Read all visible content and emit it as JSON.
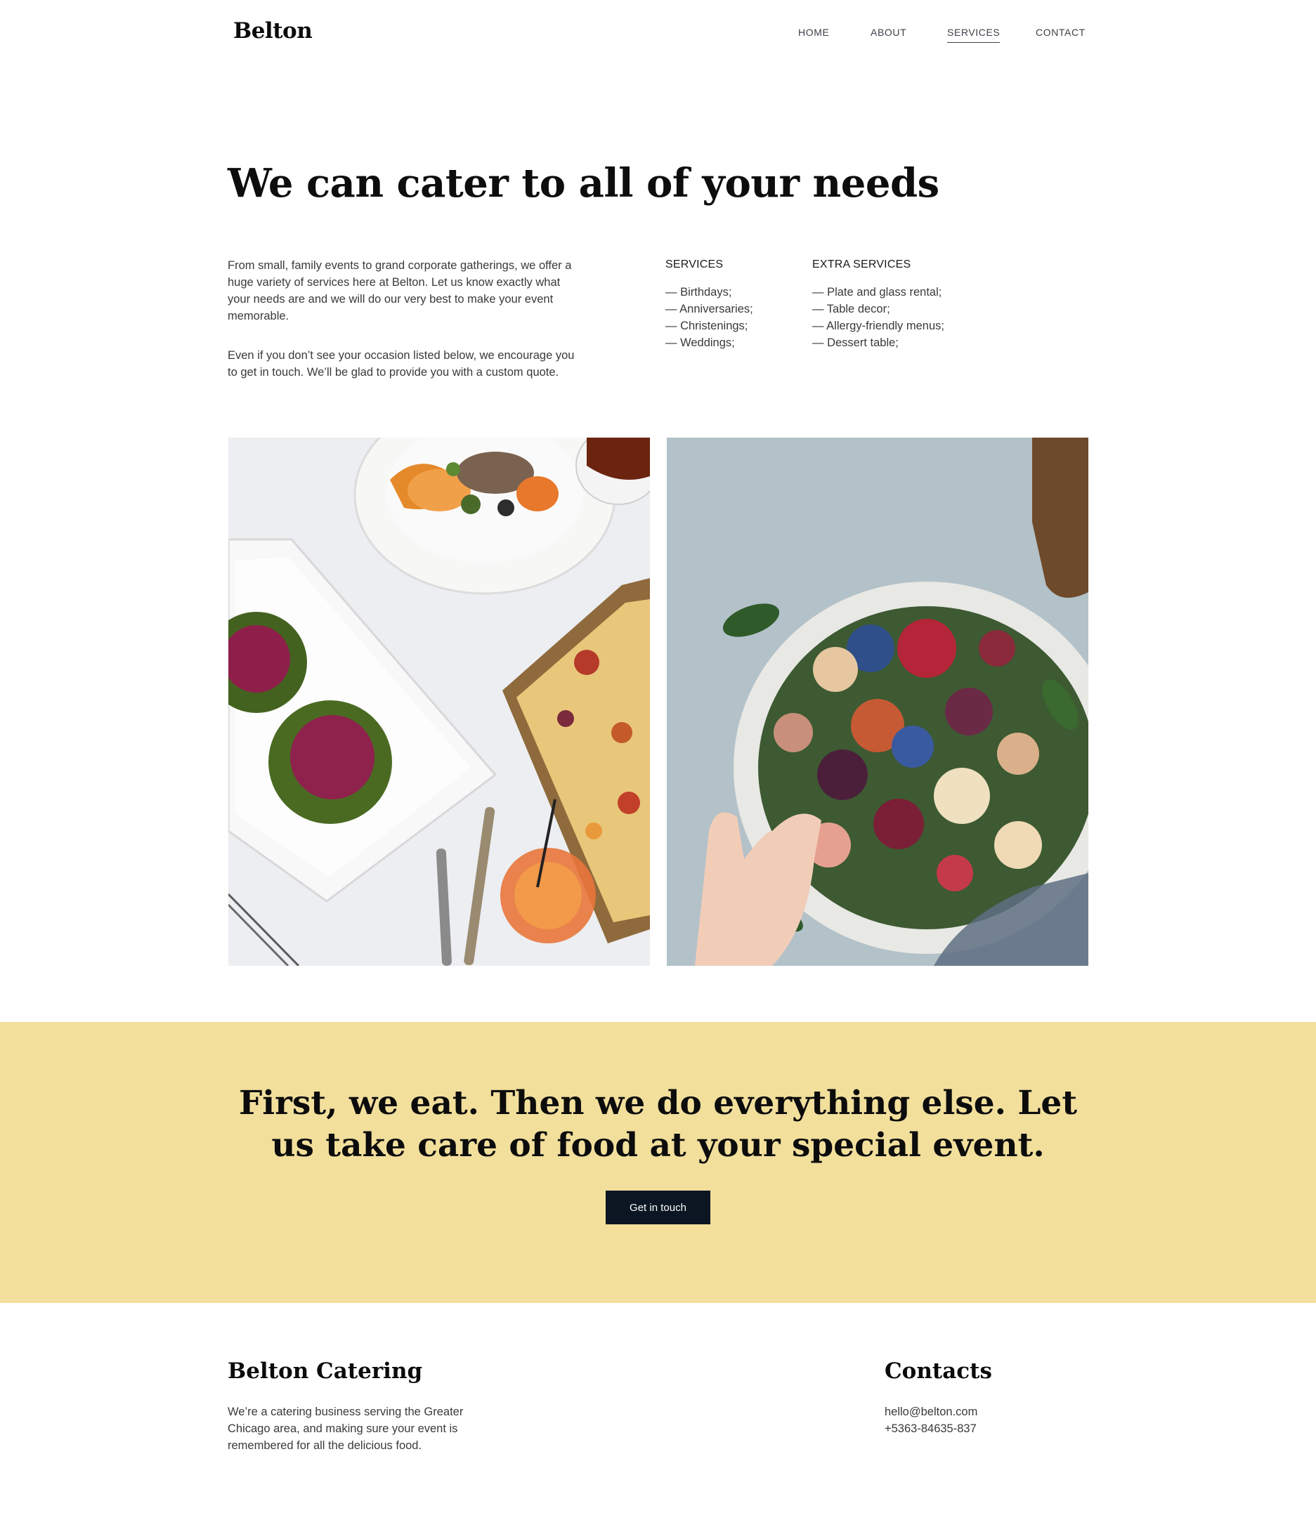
{
  "header": {
    "logo": "Belton",
    "nav": [
      {
        "label": "HOME",
        "active": false
      },
      {
        "label": "ABOUT",
        "active": false
      },
      {
        "label": "SERVICES",
        "active": true
      },
      {
        "label": "CONTACT",
        "active": false
      }
    ]
  },
  "hero": {
    "title": "We can cater to all of your needs",
    "intro": [
      "From small, family events to grand corporate gatherings, we offer a huge variety of services here at Belton. Let us know exactly what your needs are and we will do our very best to make your event memorable.",
      "Even if you don’t see your occasion listed below, we encourage you to get in touch. We’ll be glad to provide you with a custom quote."
    ],
    "services": {
      "heading": "SERVICES",
      "items": [
        "— Birthdays;",
        "— Anniversaries;",
        "— Christenings;",
        "— Weddings;"
      ]
    },
    "extra_services": {
      "heading": "EXTRA SERVICES",
      "items": [
        "— Plate and glass rental;",
        "— Table decor;",
        "— Allergy-friendly menus;",
        "— Dessert table;"
      ]
    }
  },
  "banner": {
    "headline_line1": "First, we eat. Then we do everything else. Let",
    "headline_line2": "us take care of food at your special event.",
    "cta_label": "Get in touch",
    "bg_color": "#f2df9c",
    "button_color": "#0b1622"
  },
  "footer": {
    "brand_title": "Belton Catering",
    "brand_text": [
      "We’re a catering business serving the Greater",
      "Chicago area, and making sure your event is",
      "remembered for all the delicious food."
    ],
    "contacts_title": "Contacts",
    "email": "hello@belton.com",
    "phone": "+5363-84635-837"
  }
}
